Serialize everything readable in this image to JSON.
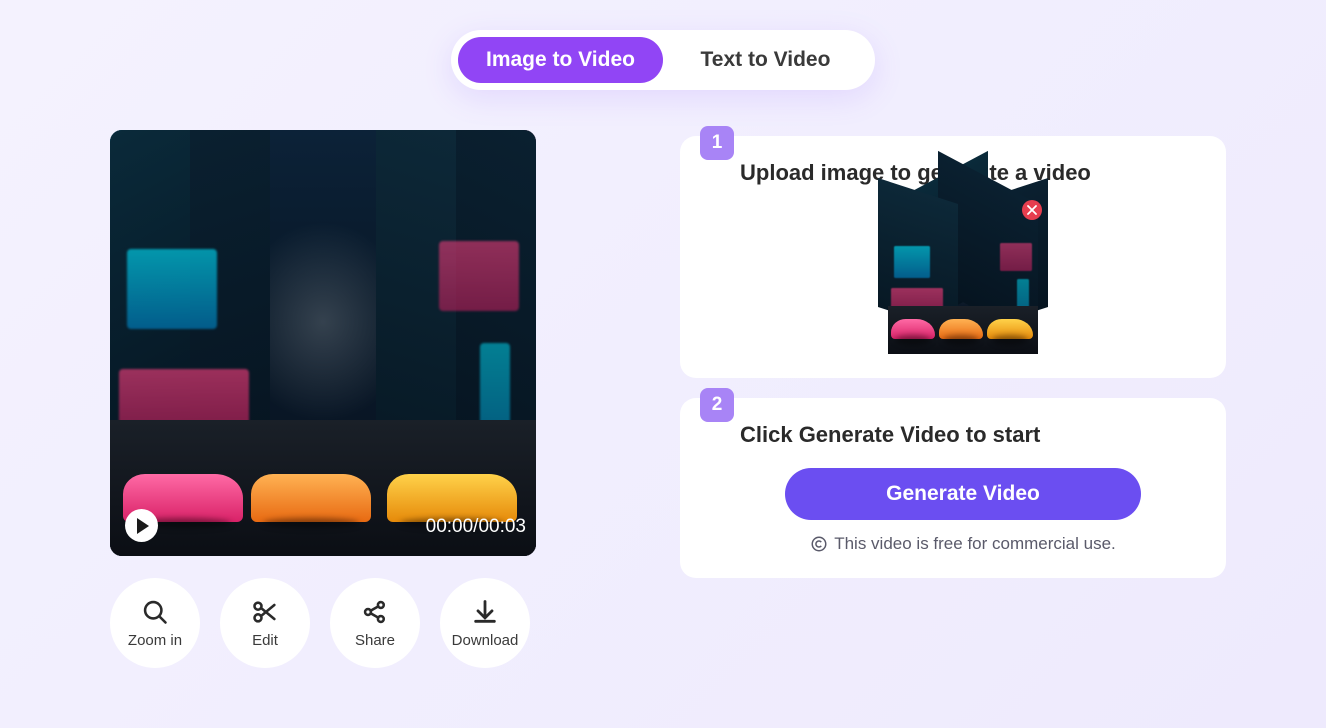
{
  "tabs": {
    "image_to_video": "Image to Video",
    "text_to_video": "Text to Video"
  },
  "preview": {
    "timestamp": "00:00/00:03"
  },
  "actions": {
    "zoom": "Zoom in",
    "edit": "Edit",
    "share": "Share",
    "download": "Download"
  },
  "steps": {
    "step1": {
      "badge": "1",
      "title": "Upload image to generate a video"
    },
    "step2": {
      "badge": "2",
      "title": "Click Generate Video to start",
      "button": "Generate Video",
      "license": "This video is free for commercial use."
    }
  }
}
